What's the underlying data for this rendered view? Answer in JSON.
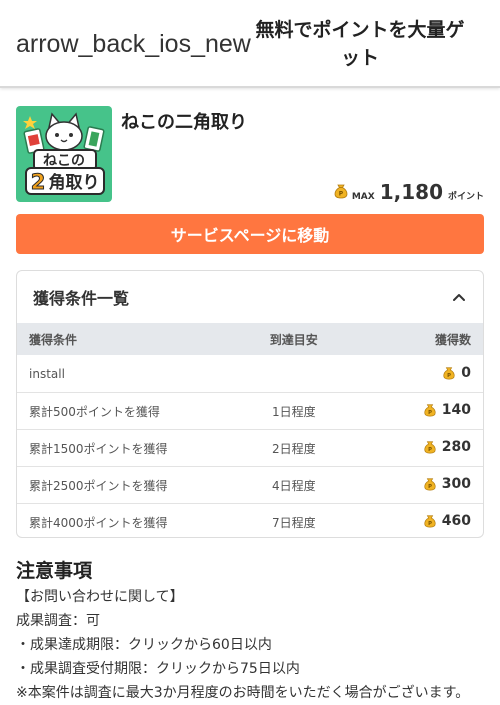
{
  "header": {
    "back_icon_text": "arrow_back_ios_new",
    "title": "無料でポイントを大量ゲット"
  },
  "app": {
    "name": "ねこの二角取り",
    "max_label": "MAX",
    "max_value": "1,180",
    "points_unit": "ポイント"
  },
  "cta": {
    "label": "サービスページに移動"
  },
  "conditions": {
    "title": "獲得条件一覧",
    "columns": [
      "獲得条件",
      "到達目安",
      "獲得数"
    ],
    "rows": [
      {
        "condition": "install",
        "eta": "",
        "points": "0"
      },
      {
        "condition": "累計500ポイントを獲得",
        "eta": "1日程度",
        "points": "140"
      },
      {
        "condition": "累計1500ポイントを獲得",
        "eta": "2日程度",
        "points": "280"
      },
      {
        "condition": "累計2500ポイントを獲得",
        "eta": "4日程度",
        "points": "300"
      },
      {
        "condition": "累計4000ポイントを獲得",
        "eta": "7日程度",
        "points": "460"
      }
    ]
  },
  "notes": {
    "title": "注意事項",
    "lines": [
      "【お問い合わせに関して】",
      "成果調査：可",
      "・成果達成期限：クリックから60日以内",
      "・成果調査受付期限：クリックから75日以内",
      "※本案件は調査に最大3か月程度のお時間をいただく場合がございます。"
    ]
  },
  "colors": {
    "cta": "#ff7640",
    "thumb_bg": "#46c38a",
    "coin": "#f0b323",
    "table_header": "#e5e8ec"
  },
  "icons": {
    "back": "arrow-back-icon",
    "collapse": "chevron-up-icon",
    "coin": "coin-bag-icon"
  }
}
